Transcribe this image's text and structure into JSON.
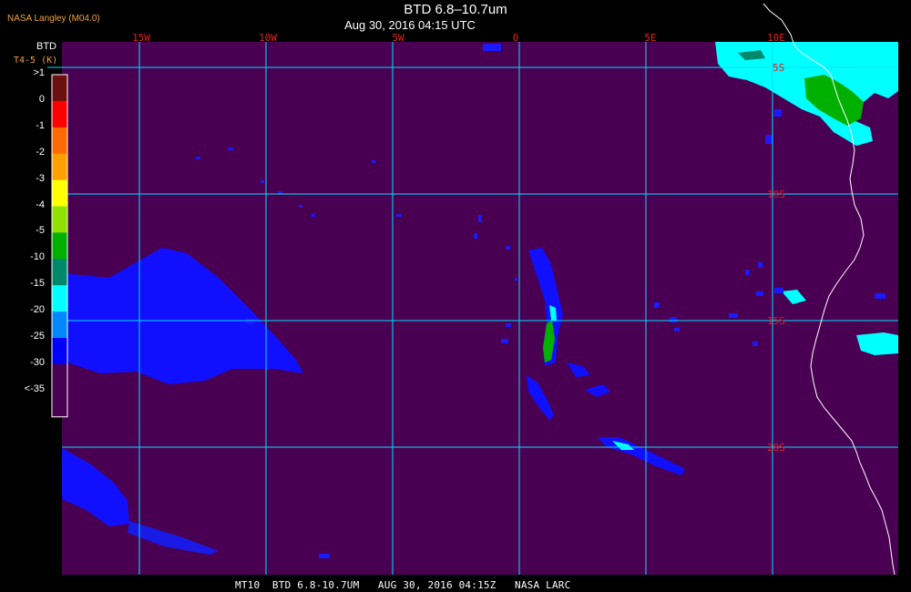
{
  "header": {
    "agency": "NASA Langley (M04.0)",
    "title": "BTD 6.8–10.7um",
    "subtitle": "Aug 30, 2016 04:15 UTC"
  },
  "legend": {
    "title": "BTD",
    "subtitle": "T4-5 (K)",
    "labels": [
      ">1",
      "0",
      "-1",
      "-2",
      "-3",
      "-4",
      "-5",
      "-10",
      "-15",
      "-20",
      "-25",
      "-30",
      "<-35"
    ],
    "colors": [
      "#6b0f0f",
      "#ff0000",
      "#ff6a00",
      "#ffa000",
      "#ffff00",
      "#90e000",
      "#00b000",
      "#00886a",
      "#00ffff",
      "#0088ff",
      "#0000ff",
      "#4a0052",
      "#4a0052"
    ]
  },
  "map": {
    "background_color": "#4a0052",
    "grid_color": "#00e0ff",
    "longitude_labels": [
      "15W",
      "10W",
      "5W",
      "0",
      "5E",
      "10E"
    ],
    "latitude_labels": [
      "5S",
      "10S",
      "15S",
      "20S"
    ],
    "label_color": "#e02020"
  },
  "footer": {
    "text": "MT10  BTD 6.8-10.7UM   AUG 30, 2016 04:15Z   NASA LARC"
  }
}
